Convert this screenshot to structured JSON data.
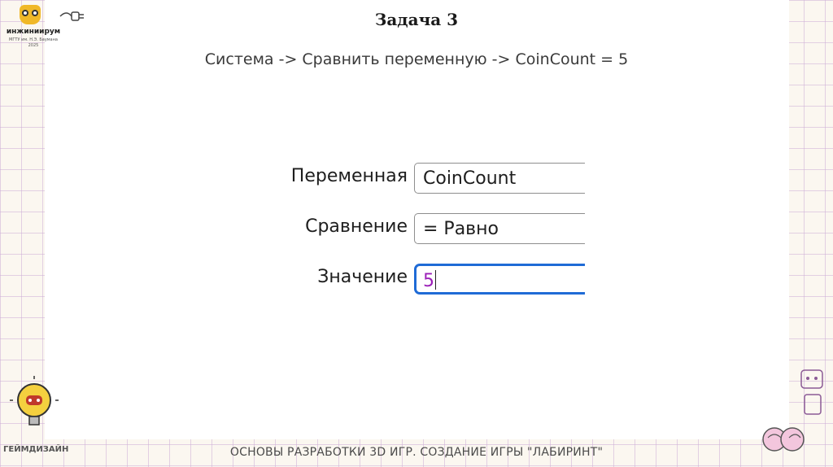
{
  "header": {
    "title": "Задача 3",
    "path": "Система -> Сравнить переменную -> CoinCount = 5"
  },
  "logo": {
    "brand": "инжиниирум",
    "sub": "МГТУ им. Н.Э. Баумана 2025"
  },
  "form": {
    "variable_label": "Переменная",
    "variable_value": "CoinCount",
    "compare_label": "Сравнение",
    "compare_value": "= Равно",
    "value_label": "Значение",
    "value_value": "5"
  },
  "footer": {
    "course": "ОСНОВЫ РАЗРАБОТКИ 3D ИГР. СОЗДАНИЕ ИГРЫ \"ЛАБИРИНТ\"",
    "section": "ГЕЙМДИЗАЙН"
  },
  "colors": {
    "accent_border": "#1f6bd6",
    "value_text": "#9b1fb8",
    "grid": "#cdafd7"
  },
  "icons": [
    "owl-logo-icon",
    "plug-icon",
    "lightbulb-gamepad-icon",
    "brain-icon"
  ]
}
